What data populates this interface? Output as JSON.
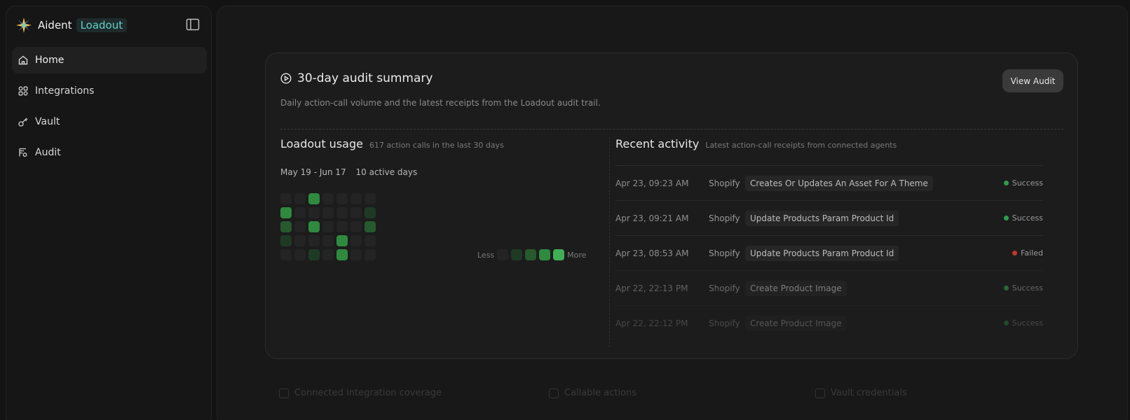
{
  "brand": {
    "name": "Aident",
    "tag": "Loadout"
  },
  "sidebar": {
    "items": [
      {
        "label": "Home",
        "icon": "home-icon",
        "active": true
      },
      {
        "label": "Integrations",
        "icon": "grid-icon",
        "active": false
      },
      {
        "label": "Vault",
        "icon": "key-icon",
        "active": false
      },
      {
        "label": "Audit",
        "icon": "audit-icon",
        "active": false
      }
    ]
  },
  "card": {
    "title": "30-day audit summary",
    "description": "Daily action-call volume and the latest receipts from the Loadout audit trail.",
    "view_audit_label": "View Audit"
  },
  "usage": {
    "title": "Loadout usage",
    "subtitle": "617 action calls in the last 30 days",
    "date_range": "May 19 - Jun 17",
    "active_days": "10 active days",
    "legend_less": "Less",
    "legend_more": "More",
    "heatmap_levels": [
      [
        0,
        0,
        3,
        0,
        0,
        0,
        0
      ],
      [
        3,
        0,
        0,
        0,
        0,
        0,
        1
      ],
      [
        2,
        0,
        3,
        0,
        0,
        0,
        2
      ],
      [
        1,
        0,
        0,
        0,
        3,
        0,
        0
      ],
      [
        0,
        0,
        1,
        0,
        3,
        0,
        0
      ]
    ]
  },
  "activity": {
    "title": "Recent activity",
    "subtitle": "Latest action-call receipts from connected agents",
    "rows": [
      {
        "time": "Apr 23, 09:23 AM",
        "vendor": "Shopify",
        "action": "Creates Or Updates An Asset For A Theme",
        "status": "Success"
      },
      {
        "time": "Apr 23, 09:21 AM",
        "vendor": "Shopify",
        "action": "Update Products Param Product Id",
        "status": "Success"
      },
      {
        "time": "Apr 23, 08:53 AM",
        "vendor": "Shopify",
        "action": "Update Products Param Product Id",
        "status": "Failed"
      },
      {
        "time": "Apr 22, 22:13 PM",
        "vendor": "Shopify",
        "action": "Create Product Image",
        "status": "Success"
      },
      {
        "time": "Apr 22, 22:12 PM",
        "vendor": "Shopify",
        "action": "Create Product Image",
        "status": "Success"
      }
    ]
  },
  "bottom": {
    "items": [
      "Connected integration coverage",
      "Callable actions",
      "Vault credentials"
    ]
  },
  "colors": {
    "success": "#2e9e4a",
    "failed": "#c0392b",
    "heat": [
      "#242424",
      "#1f3a24",
      "#27592f",
      "#2f8a3f"
    ]
  }
}
